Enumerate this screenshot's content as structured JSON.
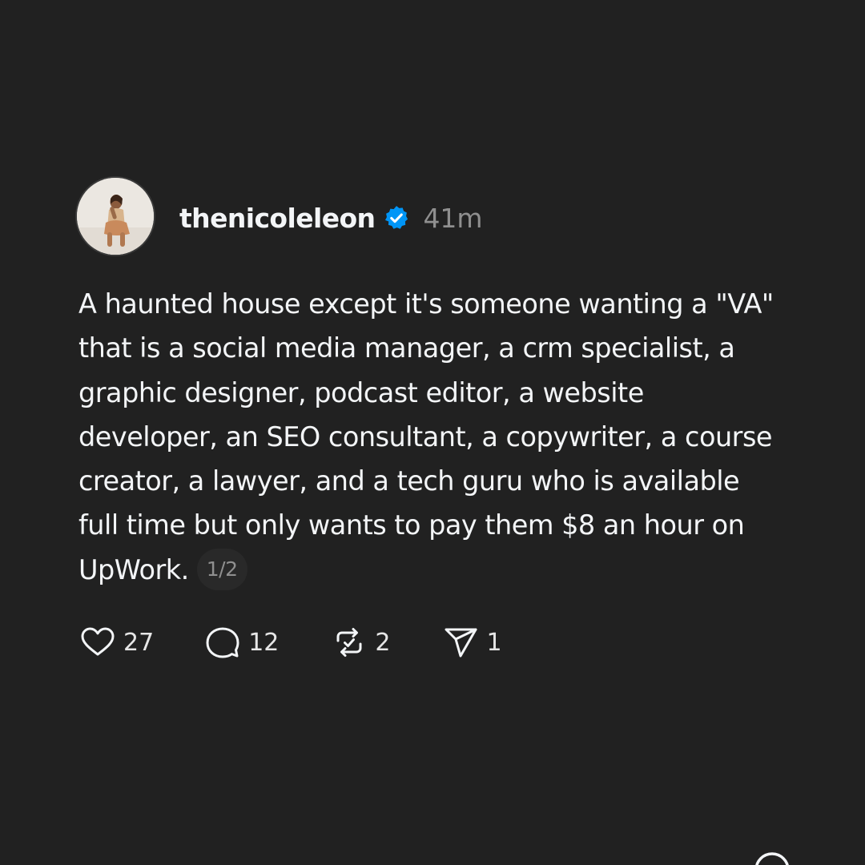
{
  "post": {
    "username": "thenicoleleon",
    "timestamp": "41m",
    "verified_icon": "verified-badge-icon",
    "text": "A haunted house except it's someone wanting a \"VA\" that is a social media manager, a crm specialist, a graphic designer, podcast editor, a website developer, an SEO consultant, a copywriter, a course creator, a lawyer, and a tech guru who is available full time but only wants to pay them $8 an hour on UpWork.",
    "page_indicator": "1/2"
  },
  "actions": {
    "likes": "27",
    "comments": "12",
    "reposts": "2",
    "shares": "1"
  },
  "icons": {
    "like": "heart-icon",
    "comment": "comment-bubble-icon",
    "repost": "repost-icon",
    "share": "send-icon"
  },
  "colors": {
    "background": "#212121",
    "text": "#f3f5f7",
    "muted": "#8f8f8f",
    "verified": "#0095f6"
  }
}
